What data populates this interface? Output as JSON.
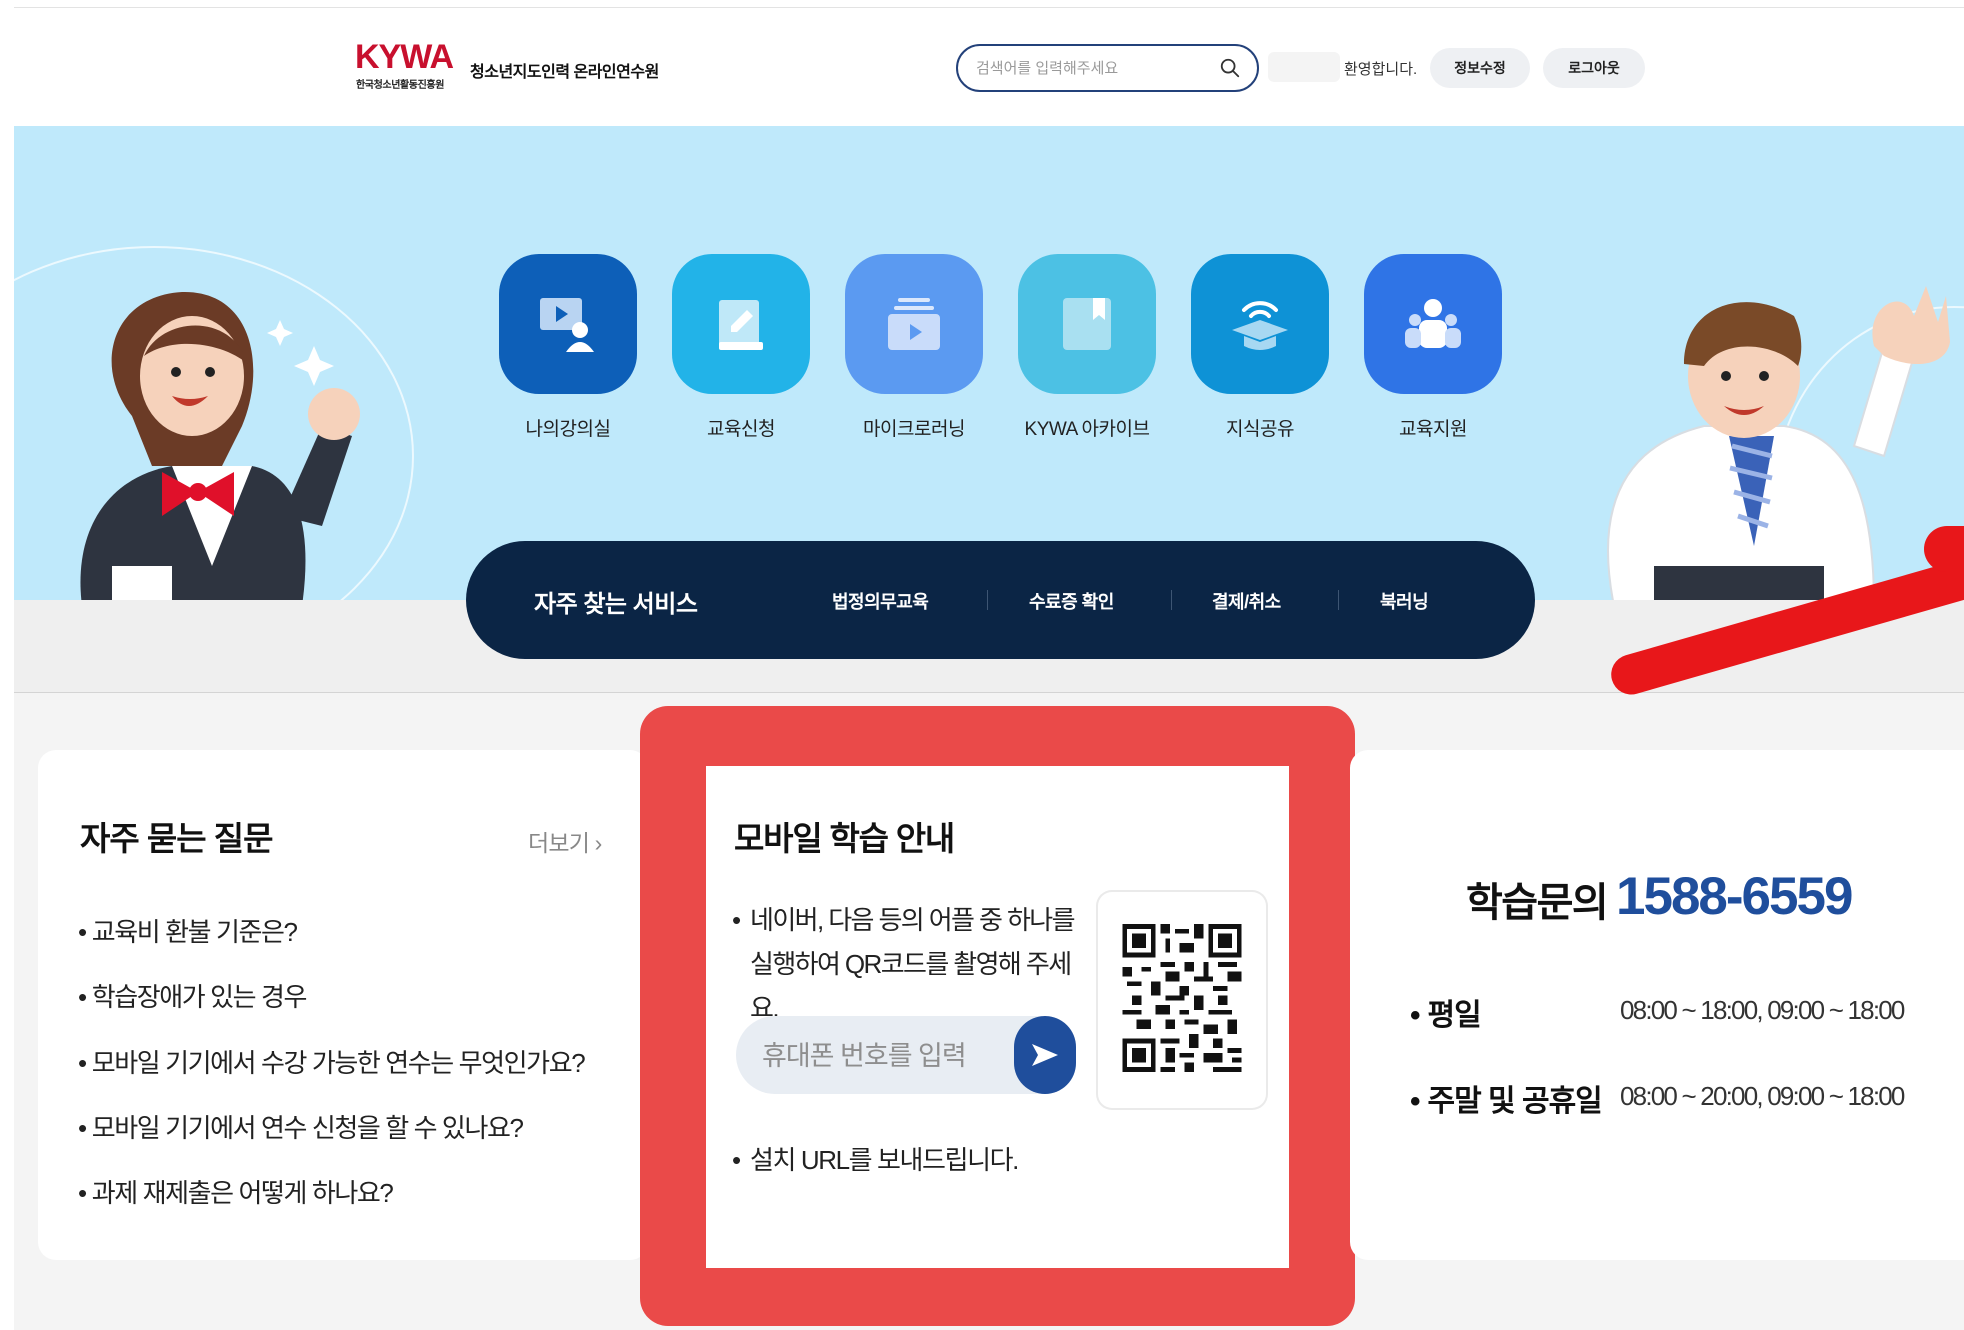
{
  "header": {
    "logo_text": "KYWA",
    "logo_subtitle": "한국청소년활동진흥원",
    "site_title": "청소년지도인력 온라인연수원",
    "search_placeholder": "검색어를 입력해주세요",
    "welcome": "환영합니다.",
    "profile_button": "정보수정",
    "logout_button": "로그아웃"
  },
  "main_menu": [
    {
      "label": "나의강의실",
      "icon": "video-classroom-icon",
      "color": "#0d5fb8"
    },
    {
      "label": "교육신청",
      "icon": "edit-document-icon",
      "color": "#22b3e8"
    },
    {
      "label": "마이크로러닝",
      "icon": "video-folder-icon",
      "color": "#5b9af1"
    },
    {
      "label": "KYWA 아카이브",
      "icon": "book-bookmark-icon",
      "color": "#4cc1e4"
    },
    {
      "label": "지식공유",
      "icon": "graduation-cap-wifi-icon",
      "color": "#0e92d6"
    },
    {
      "label": "교육지원",
      "icon": "people-group-icon",
      "color": "#2f74e6"
    }
  ],
  "quick_services": {
    "title": "자주 찾는 서비스",
    "links": [
      "법정의무교육",
      "수료증 확인",
      "결제/취소",
      "북러닝"
    ]
  },
  "faq": {
    "title": "자주 묻는 질문",
    "more": "더보기 ›",
    "items": [
      "교육비 환불 기준은?",
      "학습장애가 있는 경우",
      "모바일 기기에서 수강 가능한 연수는 무엇인가요?",
      "모바일 기기에서 연수 신청을 할 수 있나요?",
      "과제 재제출은 어떻게 하나요?"
    ]
  },
  "mobile": {
    "title": "모바일 학습 안내",
    "desc_line1": "네이버, 다음 등의 어플 중 하나를",
    "desc_line2": "실행하여 QR코드를 촬영해 주세요.",
    "phone_placeholder": "휴대폰 번호를 입력",
    "note": "설치 URL를 보내드립니다."
  },
  "contact": {
    "title": "학습문의",
    "phone": "1588-6559",
    "hours": [
      {
        "label": "평일",
        "value": "08:00 ~ 18:00, 09:00 ~ 18:00"
      },
      {
        "label": "주말 및 공휴일",
        "value": "08:00 ~ 20:00, 09:00 ~ 18:00"
      }
    ]
  },
  "colors": {
    "navy": "#0b2545",
    "accent_blue": "#1f4e9c",
    "hero_bg": "#bfe9fb",
    "annotation_red": "#ea4a49"
  }
}
